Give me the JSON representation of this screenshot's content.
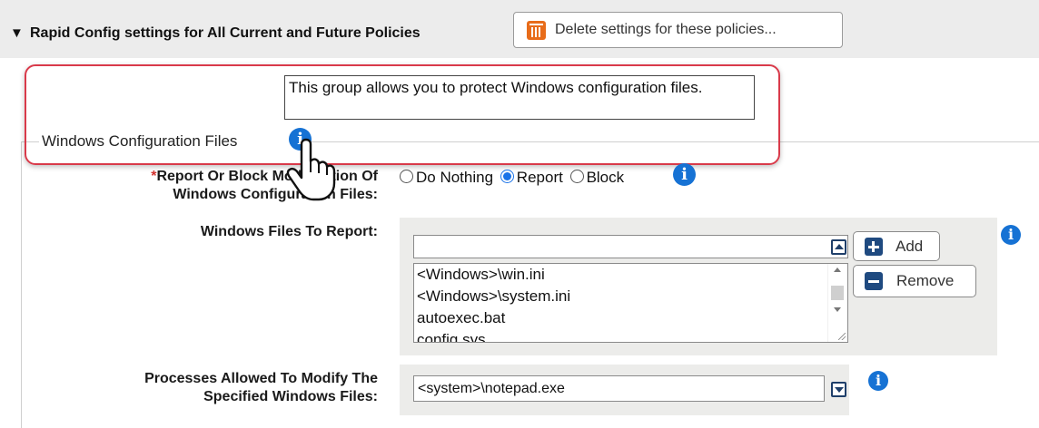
{
  "section": {
    "title": "Rapid Config settings for All Current and Future Policies",
    "delete_button": "Delete settings for these policies..."
  },
  "tooltip": {
    "text": "This group allows you to protect Windows configuration files."
  },
  "group": {
    "legend": "Windows Configuration Files"
  },
  "report_block": {
    "required_marker": "*",
    "label_line1": "Report Or Block Modification Of",
    "label_line2": "Windows Configuration Files:",
    "options": [
      "Do Nothing",
      "Report",
      "Block"
    ],
    "selected": "Report"
  },
  "files_to_report": {
    "label": "Windows Files To Report:",
    "input_value": "",
    "items": [
      "<Windows>\\win.ini",
      "<Windows>\\system.ini",
      "autoexec.bat",
      "config.sys"
    ],
    "add_label": "Add",
    "remove_label": "Remove"
  },
  "processes": {
    "label_line1": "Processes Allowed To Modify The",
    "label_line2": "Specified Windows Files:",
    "value": "<system>\\notepad.exe"
  },
  "colors": {
    "accent_blue": "#1672d4",
    "highlight_red": "#d93a4a",
    "trash_orange": "#e86c1a",
    "button_navy": "#1f4a80"
  },
  "icons": {
    "info": "i"
  }
}
